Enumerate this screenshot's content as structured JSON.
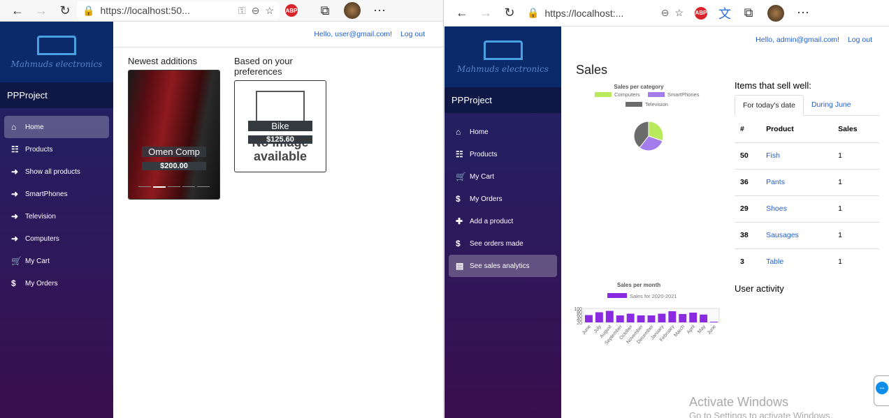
{
  "left": {
    "url": "https://localhost:50...",
    "brand": "Mahmuds electronics",
    "project": "PPProject",
    "nav": [
      {
        "icon": "⌂",
        "label": "Home",
        "active": true
      },
      {
        "icon": "☷",
        "label": "Products"
      },
      {
        "icon": "➜",
        "label": "Show all products"
      },
      {
        "icon": "➜",
        "label": "SmartPhones"
      },
      {
        "icon": "➜",
        "label": "Television"
      },
      {
        "icon": "➜",
        "label": "Computers"
      },
      {
        "icon": "🛒",
        "label": "My Cart"
      },
      {
        "icon": "$",
        "label": "My Orders"
      }
    ],
    "greeting": "Hello, user@gmail.com!",
    "logout": "Log out",
    "newest_title": "Newest additions",
    "pref_title": "Based on your preferences",
    "newest": {
      "name": "Omen Comp",
      "price": "$200.00"
    },
    "pref": {
      "name": "Bike",
      "price": "$125.60",
      "placeholder": "No image available"
    }
  },
  "right": {
    "url": "https://localhost:...",
    "brand": "Mahmuds electronics",
    "project": "PPProject",
    "nav": [
      {
        "icon": "⌂",
        "label": "Home"
      },
      {
        "icon": "☷",
        "label": "Products"
      },
      {
        "icon": "🛒",
        "label": "My Cart"
      },
      {
        "icon": "$",
        "label": "My Orders"
      },
      {
        "icon": "✚",
        "label": "Add a product"
      },
      {
        "icon": "$",
        "label": "See orders made"
      },
      {
        "icon": "▤",
        "label": "See sales analytics",
        "active": true
      }
    ],
    "greeting": "Hello, admin@gmail.com!",
    "logout": "Log out",
    "title": "Sales",
    "sell_title": "Items that sell well:",
    "tabs": [
      "For today's date",
      "During June"
    ],
    "columns": [
      "#",
      "Product",
      "Sales"
    ],
    "rows": [
      [
        "50",
        "Fish",
        "1"
      ],
      [
        "36",
        "Pants",
        "1"
      ],
      [
        "29",
        "Shoes",
        "1"
      ],
      [
        "38",
        "Sausages",
        "1"
      ],
      [
        "3",
        "Table",
        "1"
      ]
    ],
    "activity": "User activity",
    "watermark": {
      "title": "Activate Windows",
      "sub": "Go to Settings to activate Windows."
    }
  },
  "chart_data": [
    {
      "type": "pie",
      "title": "Sales per category",
      "labels": [
        "Computers",
        "SmartPhones",
        "Television"
      ],
      "values": [
        1,
        1,
        1.3
      ],
      "colors": [
        "#b9ea5c",
        "#a47ded",
        "#6b6b6b"
      ],
      "legend": "top"
    },
    {
      "type": "bar",
      "title": "Sales per month",
      "legend": [
        "Sales for 2020-2021"
      ],
      "color": "#8a2be2",
      "categories": [
        "June",
        "July",
        "August",
        "September",
        "October",
        "November",
        "December",
        "January",
        "February",
        "March",
        "April",
        "May",
        "June"
      ],
      "values": [
        62,
        78,
        86,
        60,
        70,
        60,
        60,
        70,
        84,
        68,
        76,
        65,
        22
      ],
      "yticks": [
        "100",
        "80",
        "60",
        "40",
        "20"
      ],
      "ylim": [
        20,
        100
      ]
    }
  ]
}
